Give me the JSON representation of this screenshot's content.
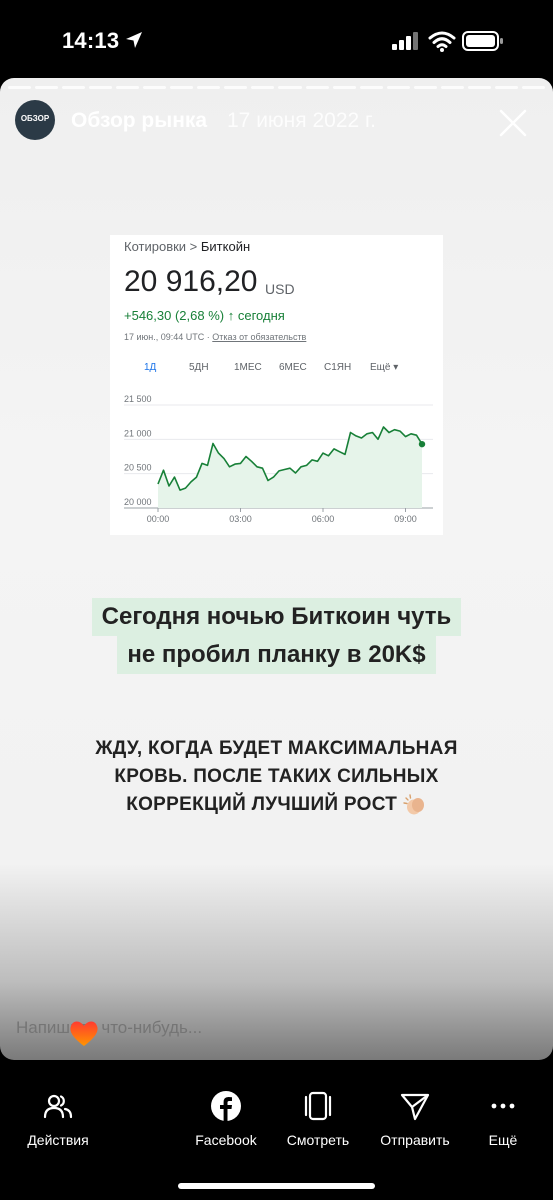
{
  "status_bar": {
    "time": "14:13"
  },
  "story": {
    "account_name": "Обзор рынка",
    "date": "17 июня 2022 г.",
    "avatar_text": "ОБЗОР"
  },
  "quote": {
    "breadcrumb_root": "Котировки",
    "breadcrumb_sep": " > ",
    "breadcrumb_leaf": "Биткойн",
    "price": "20 916,20",
    "currency": "USD",
    "change": "+546,30 (2,68 %)",
    "change_period": "сегодня",
    "timestamp": "17 июн., 09:44 UTC · ",
    "disclaimer_link": "Отказ от обязательств",
    "ranges": [
      "1Д",
      "5ДН",
      "1МЕС",
      "6МЕС",
      "С1ЯН"
    ],
    "more_label": "Ещё",
    "active_range": "1Д"
  },
  "chart_data": {
    "type": "area",
    "x_ticks": [
      "00:00",
      "03:00",
      "06:00",
      "09:00"
    ],
    "y_ticks": [
      "21 500",
      "21 000",
      "20 500",
      "20 000"
    ],
    "ylim": [
      20000,
      21500
    ],
    "xlim": [
      0,
      10
    ],
    "color": "#188038",
    "fill": "#e6f4ea",
    "series": [
      {
        "x": [
          0,
          0.2,
          0.4,
          0.6,
          0.8,
          1.0,
          1.2,
          1.4,
          1.6,
          1.8,
          2.0,
          2.2,
          2.4,
          2.6,
          2.8,
          3.0,
          3.2,
          3.4,
          3.6,
          3.8,
          4.0,
          4.2,
          4.4,
          4.6,
          4.8,
          5.0,
          5.2,
          5.4,
          5.6,
          5.8,
          6.0,
          6.2,
          6.4,
          6.6,
          6.8,
          7.0,
          7.2,
          7.4,
          7.6,
          7.8,
          8.0,
          8.2,
          8.4,
          8.6,
          8.8,
          9.0,
          9.2,
          9.4,
          9.6
        ],
        "values": [
          20350,
          20550,
          20320,
          20450,
          20260,
          20290,
          20380,
          20450,
          20650,
          20620,
          20940,
          20800,
          20720,
          20600,
          20640,
          20650,
          20750,
          20680,
          20600,
          20580,
          20400,
          20450,
          20540,
          20560,
          20580,
          20510,
          20600,
          20620,
          20700,
          20680,
          20800,
          20760,
          20860,
          20820,
          20780,
          21100,
          21050,
          21020,
          21080,
          21100,
          21000,
          21180,
          21100,
          21140,
          21120,
          21040,
          21080,
          21060,
          20930
        ]
      }
    ]
  },
  "headline": {
    "line1": "Сегодня ночью Биткоин чуть",
    "line2": "не пробил планку в 20K$"
  },
  "body": {
    "line1": "ЖДУ, КОГДА БУДЕТ МАКСИМАЛЬНАЯ",
    "line2": "КРОВЬ. ПОСЛЕ ТАКИХ СИЛЬНЫХ",
    "line3": "КОРРЕКЦИЙ ЛУЧШИЙ РОСТ"
  },
  "reply": {
    "placeholder": "Напишите что-нибудь..."
  },
  "bottom_bar": {
    "actions": "Действия",
    "facebook": "Facebook",
    "watch": "Смотреть",
    "send": "Отправить",
    "more": "Ещё"
  }
}
